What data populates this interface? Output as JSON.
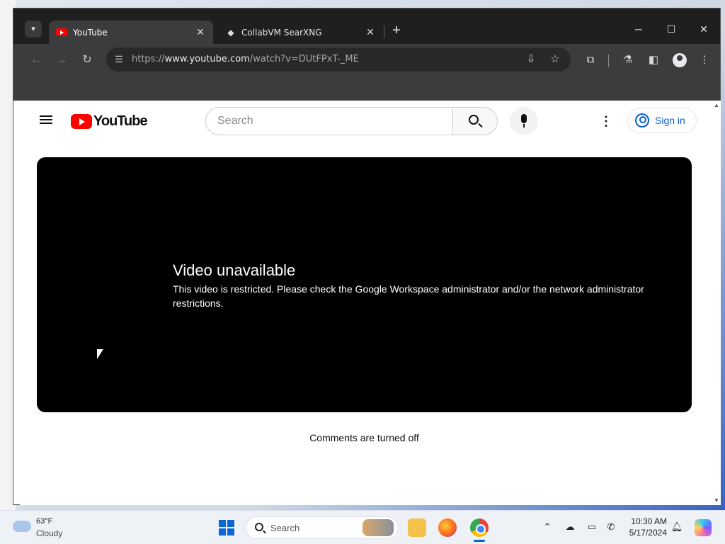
{
  "browser": {
    "tabs": [
      {
        "title": "YouTube",
        "active": true
      },
      {
        "title": "CollabVM SearXNG",
        "active": false
      }
    ],
    "url": {
      "scheme": "https://",
      "host": "www.youtube.com",
      "path": "/watch?v=DUtFPxT-_ME"
    }
  },
  "youtube": {
    "logo_text": "YouTube",
    "search_placeholder": "Search",
    "sign_in_label": "Sign in",
    "error_title": "Video unavailable",
    "error_message": "This video is restricted. Please check the Google Workspace administrator and/or the network administrator restrictions.",
    "comments_status": "Comments are turned off"
  },
  "taskbar": {
    "weather_temp": "63°F",
    "weather_condition": "Cloudy",
    "search_label": "Search",
    "time": "10:30 AM",
    "date": "5/17/2024"
  },
  "colors": {
    "youtube_red": "#ff0000",
    "signin_blue": "#065fd4",
    "browser_dark": "#1f1f1f"
  }
}
